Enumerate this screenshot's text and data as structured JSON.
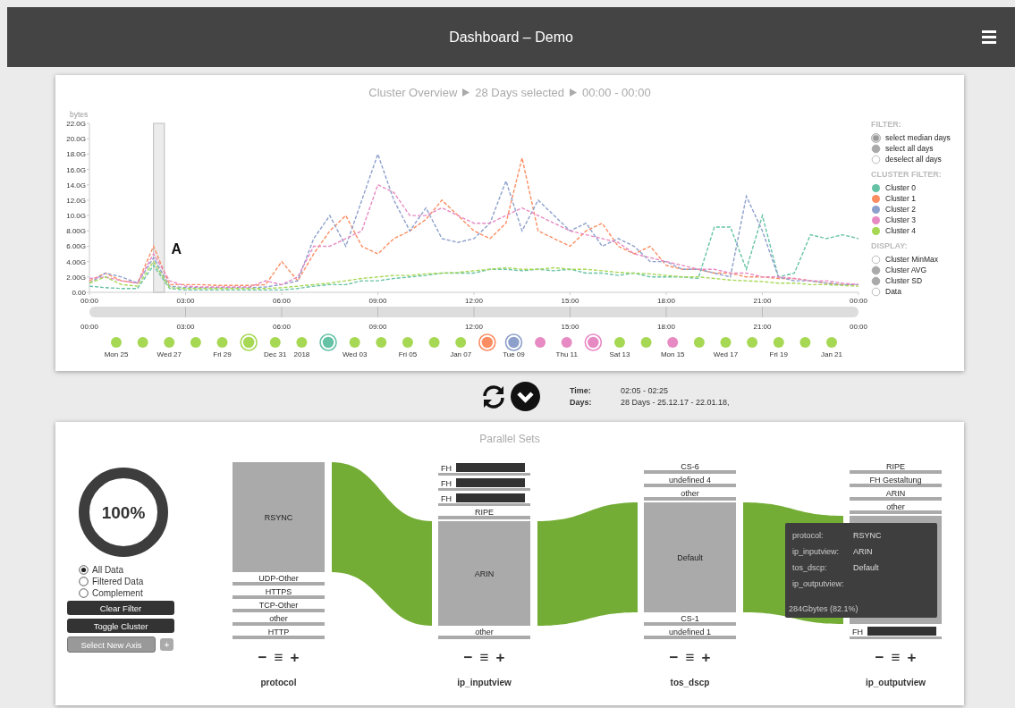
{
  "header": {
    "title": "Dashboard – Demo"
  },
  "overview": {
    "title_parts": [
      "Cluster Overview",
      "28 Days selected",
      "00:00 - 00:00"
    ],
    "chart_data": {
      "type": "line",
      "ylabel": "bytes",
      "xlim": [
        0,
        24
      ],
      "ylim": [
        0,
        22
      ],
      "x": [
        0,
        0.5,
        1,
        1.5,
        2,
        2.5,
        3,
        3.5,
        4,
        4.5,
        5,
        5.5,
        6,
        6.5,
        7,
        7.5,
        8,
        8.5,
        9,
        9.5,
        10,
        10.5,
        11,
        11.5,
        12,
        12.5,
        13,
        13.5,
        14,
        14.5,
        15,
        15.5,
        16,
        16.5,
        17,
        17.5,
        18,
        18.5,
        19,
        19.5,
        20,
        20.5,
        21,
        21.5,
        22,
        22.5,
        23,
        23.5,
        24
      ],
      "xticks": [
        {
          "value": 0,
          "label": "00:00"
        },
        {
          "value": 3,
          "label": "03:00"
        },
        {
          "value": 6,
          "label": "06:00"
        },
        {
          "value": 9,
          "label": "09:00"
        },
        {
          "value": 12,
          "label": "12:00"
        },
        {
          "value": 15,
          "label": "15:00"
        },
        {
          "value": 18,
          "label": "18:00"
        },
        {
          "value": 21,
          "label": "21:00"
        },
        {
          "value": 24,
          "label": "00:00"
        }
      ],
      "yticks": [
        {
          "value": 0,
          "label": "0.00"
        },
        {
          "value": 2,
          "label": "2.00G"
        },
        {
          "value": 4,
          "label": "4.00G"
        },
        {
          "value": 6,
          "label": "6.00G"
        },
        {
          "value": 8,
          "label": "8.00G"
        },
        {
          "value": 10,
          "label": "10.0G"
        },
        {
          "value": 12,
          "label": "12.0G"
        },
        {
          "value": 14,
          "label": "14.0G"
        },
        {
          "value": 16,
          "label": "16.0G"
        },
        {
          "value": 18,
          "label": "18.0G"
        },
        {
          "value": 20,
          "label": "20.0G"
        },
        {
          "value": 22,
          "label": "22.0G"
        }
      ],
      "series": [
        {
          "name": "Cluster 0",
          "color": "#66c2a5",
          "line_style": "dashed",
          "values": [
            0.8,
            0.6,
            0.5,
            0.5,
            3.5,
            0.5,
            0.3,
            0.3,
            0.3,
            0.3,
            0.3,
            0.3,
            0.3,
            0.5,
            0.8,
            1.0,
            1.0,
            1.5,
            1.5,
            1.8,
            2.0,
            2.2,
            2.5,
            2.5,
            2.5,
            3.0,
            3.0,
            2.8,
            3.0,
            2.8,
            3.0,
            2.5,
            2.5,
            2.2,
            2.5,
            2.0,
            2.0,
            2.0,
            1.8,
            8.5,
            8.5,
            3.0,
            10.0,
            2.0,
            2.5,
            7.5,
            7.0,
            7.5,
            7.0
          ]
        },
        {
          "name": "Cluster 1",
          "color": "#fc8d62",
          "line_style": "dashed",
          "values": [
            1.5,
            2.5,
            1.5,
            1.2,
            6.0,
            1.0,
            1.0,
            1.0,
            0.9,
            0.9,
            0.9,
            1.0,
            4.0,
            1.5,
            5.0,
            8.0,
            10.0,
            6.0,
            5.0,
            7.0,
            8.0,
            9.5,
            12.0,
            10.0,
            8.0,
            7.0,
            9.0,
            17.5,
            8.0,
            7.0,
            6.0,
            8.0,
            9.0,
            6.0,
            5.0,
            6.0,
            3.5,
            3.0,
            3.0,
            2.5,
            2.5,
            2.0,
            2.0,
            1.8,
            1.8,
            1.5,
            1.2,
            1.0,
            1.0
          ]
        },
        {
          "name": "Cluster 2",
          "color": "#8da0cb",
          "line_style": "dashed",
          "values": [
            1.2,
            2.5,
            2.0,
            1.2,
            4.5,
            0.8,
            0.6,
            0.6,
            0.6,
            0.6,
            0.6,
            0.7,
            1.0,
            1.5,
            7.0,
            10.0,
            6.0,
            12.0,
            18.0,
            12.0,
            8.0,
            11.0,
            7.0,
            6.5,
            7.0,
            9.0,
            14.5,
            8.0,
            12.0,
            10.0,
            8.0,
            9.0,
            6.0,
            7.0,
            6.0,
            4.0,
            4.0,
            3.0,
            3.0,
            2.5,
            2.0,
            12.5,
            8.0,
            2.0,
            1.5,
            1.5,
            1.2,
            1.0,
            1.0
          ]
        },
        {
          "name": "Cluster 3",
          "color": "#e78ac3",
          "line_style": "dashed",
          "values": [
            1.8,
            2.0,
            1.5,
            1.2,
            5.0,
            1.5,
            0.8,
            0.7,
            0.7,
            0.7,
            0.7,
            1.5,
            1.0,
            2.0,
            6.0,
            6.0,
            7.0,
            8.0,
            14.0,
            13.0,
            10.0,
            10.0,
            11.0,
            10.0,
            9.0,
            9.0,
            10.0,
            11.0,
            10.0,
            9.0,
            8.0,
            7.5,
            7.0,
            6.5,
            5.0,
            4.5,
            4.0,
            3.5,
            3.0,
            3.0,
            2.5,
            2.5,
            2.0,
            2.0,
            1.8,
            1.5,
            1.5,
            1.2,
            1.0
          ]
        },
        {
          "name": "Cluster 4",
          "color": "#a6d854",
          "line_style": "dashed",
          "values": [
            1.2,
            2.0,
            1.0,
            0.8,
            4.0,
            0.6,
            0.5,
            0.5,
            0.5,
            0.5,
            0.5,
            0.5,
            0.6,
            0.8,
            1.0,
            1.2,
            1.5,
            1.8,
            2.0,
            2.2,
            2.2,
            2.4,
            2.5,
            2.6,
            2.8,
            3.0,
            3.2,
            3.0,
            3.0,
            3.2,
            3.0,
            3.0,
            2.8,
            2.6,
            2.5,
            2.4,
            2.2,
            2.0,
            2.0,
            1.8,
            1.6,
            1.5,
            1.4,
            1.2,
            1.2,
            1.0,
            1.0,
            0.9,
            0.8
          ]
        }
      ],
      "bands": [
        {
          "axis": "x",
          "from": 2.0,
          "to": 2.34
        }
      ],
      "annotations": [
        "A"
      ]
    },
    "timeline": {
      "level": 1,
      "ticks": [
        "00:00",
        "03:00",
        "06:00",
        "09:00",
        "12:00",
        "15:00",
        "18:00",
        "21:00",
        "00:00"
      ]
    },
    "days": [
      {
        "label": "Mon 25",
        "color": "#a6d854",
        "selected": false
      },
      {
        "color": "#a6d854",
        "selected": false
      },
      {
        "label": "Wed 27",
        "color": "#a6d854",
        "selected": false
      },
      {
        "color": "#a6d854",
        "selected": false
      },
      {
        "label": "Fri 29",
        "color": "#a6d854",
        "selected": false
      },
      {
        "color": "#a6d854",
        "selected": true
      },
      {
        "label": "Dec 31",
        "color": "#a6d854",
        "selected": false
      },
      {
        "label": "2018",
        "color": "#a6d854",
        "selected": false
      },
      {
        "color": "#66c2a5",
        "selected": true
      },
      {
        "label": "Wed 03",
        "color": "#a6d854",
        "selected": false
      },
      {
        "color": "#a6d854",
        "selected": false
      },
      {
        "label": "Fri 05",
        "color": "#a6d854",
        "selected": false
      },
      {
        "color": "#a6d854",
        "selected": false
      },
      {
        "label": "Jan 07",
        "color": "#a6d854",
        "selected": false
      },
      {
        "color": "#fc8d62",
        "selected": true
      },
      {
        "label": "Tue 09",
        "color": "#8da0cb",
        "selected": true
      },
      {
        "color": "#e78ac3",
        "selected": false
      },
      {
        "label": "Thu 11",
        "color": "#e78ac3",
        "selected": false
      },
      {
        "color": "#e78ac3",
        "selected": true
      },
      {
        "label": "Sat 13",
        "color": "#a6d854",
        "selected": false
      },
      {
        "color": "#a6d854",
        "selected": false
      },
      {
        "label": "Mon 15",
        "color": "#e78ac3",
        "selected": false
      },
      {
        "color": "#a6d854",
        "selected": false
      },
      {
        "label": "Wed 17",
        "color": "#a6d854",
        "selected": false
      },
      {
        "color": "#a6d854",
        "selected": false
      },
      {
        "label": "Fri 19",
        "color": "#a6d854",
        "selected": false
      },
      {
        "color": "#a6d854",
        "selected": false
      },
      {
        "label": "Jan 21",
        "color": "#a6d854",
        "selected": false
      }
    ],
    "legend": {
      "sections": [
        {
          "heading": "FILTER:",
          "kind": "filter",
          "items": [
            {
              "label": "select median days",
              "selected": true,
              "checked": true
            },
            {
              "label": "select all days",
              "selected": false,
              "checked": true
            },
            {
              "label": "deselect all days",
              "selected": false,
              "checked": false
            }
          ]
        },
        {
          "heading": "CLUSTER FILTER:",
          "kind": "cluster"
        },
        {
          "heading": "DISPLAY:",
          "kind": "display",
          "items": [
            {
              "label": "Cluster MinMax",
              "checked": false
            },
            {
              "label": "Cluster AVG",
              "checked": true
            },
            {
              "label": "Cluster SD",
              "checked": true
            },
            {
              "label": "Data",
              "checked": false
            }
          ]
        }
      ]
    }
  },
  "status": {
    "rows": [
      {
        "label": "Time:",
        "value": "02:05 - 02:25"
      },
      {
        "label": "Days:",
        "value": "28 Days - 25.12.17 - 22.01.18,"
      }
    ]
  },
  "parallel_sets": {
    "title": "Parallel Sets",
    "coverage": {
      "label": "100%"
    },
    "data_options": [
      {
        "label": "All Data",
        "selected": true
      },
      {
        "label": "Filtered Data",
        "selected": false
      },
      {
        "label": "Complement",
        "selected": false
      }
    ],
    "buttons": [
      {
        "label": "Clear Filter",
        "kind": "primary"
      },
      {
        "label": "Toggle Cluster",
        "kind": "primary"
      },
      {
        "label": "Select New Axis",
        "kind": "secondary"
      },
      {
        "label": "+",
        "kind": "small"
      }
    ],
    "axes": [
      {
        "name": "protocol",
        "controls": [
          "−",
          "≡",
          "+"
        ],
        "categories": [
          {
            "label": "RSYNC",
            "flow": true
          },
          {
            "label": "UDP-Other"
          },
          {
            "label": "HTTPS"
          },
          {
            "label": "TCP-Other"
          },
          {
            "label": "other"
          },
          {
            "label": "HTTP"
          }
        ]
      },
      {
        "name": "ip_inputview",
        "controls": [
          "−",
          "≡",
          "+"
        ],
        "categories": [
          {
            "label": "FH",
            "highlighted": true
          },
          {
            "label": "FH",
            "highlighted": true
          },
          {
            "label": "FH",
            "highlighted": true
          },
          {
            "label": "RIPE"
          },
          {
            "label": "ARIN",
            "flow": true
          },
          {
            "label": "other"
          }
        ]
      },
      {
        "name": "tos_dscp",
        "controls": [
          "−",
          "≡",
          "+"
        ],
        "categories": [
          {
            "label": "CS-6"
          },
          {
            "label": "undefined 4"
          },
          {
            "label": "other"
          },
          {
            "label": "Default",
            "flow": true
          },
          {
            "label": "CS-1"
          },
          {
            "label": "undefined 1"
          }
        ]
      },
      {
        "name": "ip_outputview",
        "controls": [
          "−",
          "≡",
          "+"
        ],
        "categories": [
          {
            "label": "RIPE"
          },
          {
            "label": "FH Gestaltung"
          },
          {
            "label": "ARIN"
          },
          {
            "label": "other"
          },
          {
            "flow": true
          },
          {
            "label": "FH",
            "highlighted": true
          }
        ]
      }
    ],
    "tooltip": {
      "rows": [
        {
          "label": "protocol:",
          "value": "RSYNC"
        },
        {
          "label": "ip_inputview:",
          "value": "ARIN"
        },
        {
          "label": "tos_dscp:",
          "value": "Default"
        },
        {
          "label": "ip_outputview:"
        }
      ],
      "total": "284Gbytes (82.1%)"
    }
  }
}
